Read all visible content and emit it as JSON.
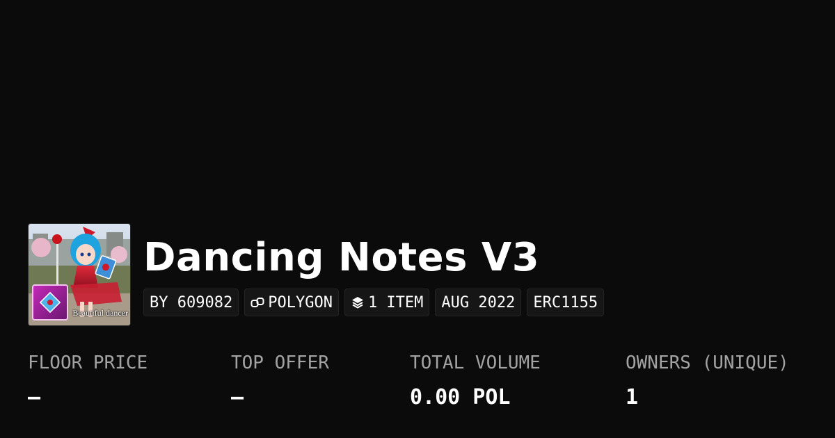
{
  "collection": {
    "title": "Dancing Notes V3",
    "thumbnail_caption": "Beautiful dancer",
    "badges": {
      "creator": "BY 609082",
      "chain": "POLYGON",
      "items": "1 ITEM",
      "date": "AUG 2022",
      "standard": "ERC1155"
    }
  },
  "stats": {
    "floor_price": {
      "label": "FLOOR PRICE",
      "value": "—"
    },
    "top_offer": {
      "label": "TOP OFFER",
      "value": "—"
    },
    "total_volume": {
      "label": "TOTAL VOLUME",
      "value": "0.00 POL"
    },
    "owners": {
      "label": "OWNERS (UNIQUE)",
      "value": "1"
    }
  },
  "icons": {
    "chain": "link-icon",
    "items": "layers-icon"
  },
  "colors": {
    "background": "#0b0b0b",
    "badge_background": "#161616",
    "label": "#a3a3a3",
    "text": "#ffffff"
  }
}
